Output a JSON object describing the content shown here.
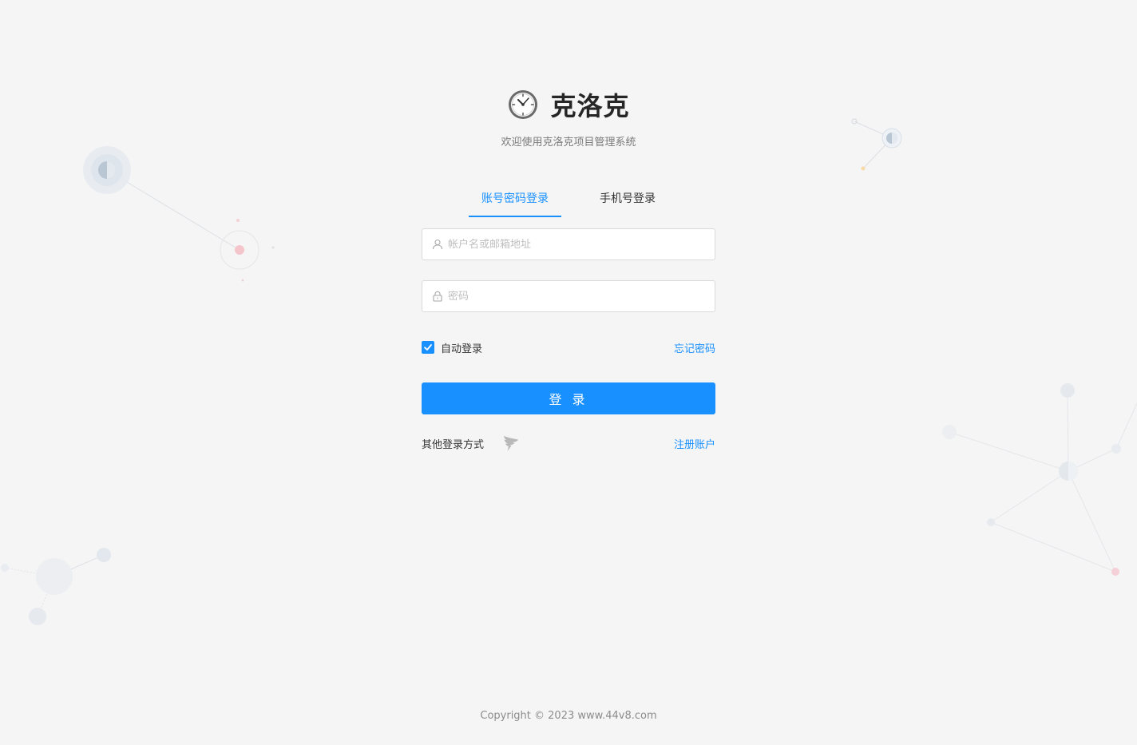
{
  "brand": {
    "title": "克洛克",
    "logo_icon": "clock-icon",
    "subtitle": "欢迎使用克洛克项目管理系统"
  },
  "tabs": [
    {
      "label": "账号密码登录",
      "active": true
    },
    {
      "label": "手机号登录",
      "active": false
    }
  ],
  "form": {
    "username": {
      "placeholder": "帐户名或邮箱地址",
      "value": "",
      "icon": "user-icon"
    },
    "password": {
      "placeholder": "密码",
      "value": "",
      "icon": "lock-icon"
    },
    "auto_login": {
      "label": "自动登录",
      "checked": true
    },
    "forgot_link": "忘记密码",
    "submit_label": "登 录",
    "other_login_label": "其他登录方式",
    "other_login_icon": "dingtalk-icon",
    "register_link": "注册账户"
  },
  "footer": {
    "copyright": "Copyright © 2023 www.44v8.com"
  },
  "colors": {
    "accent": "#1890ff",
    "background": "#f5f5f5"
  }
}
